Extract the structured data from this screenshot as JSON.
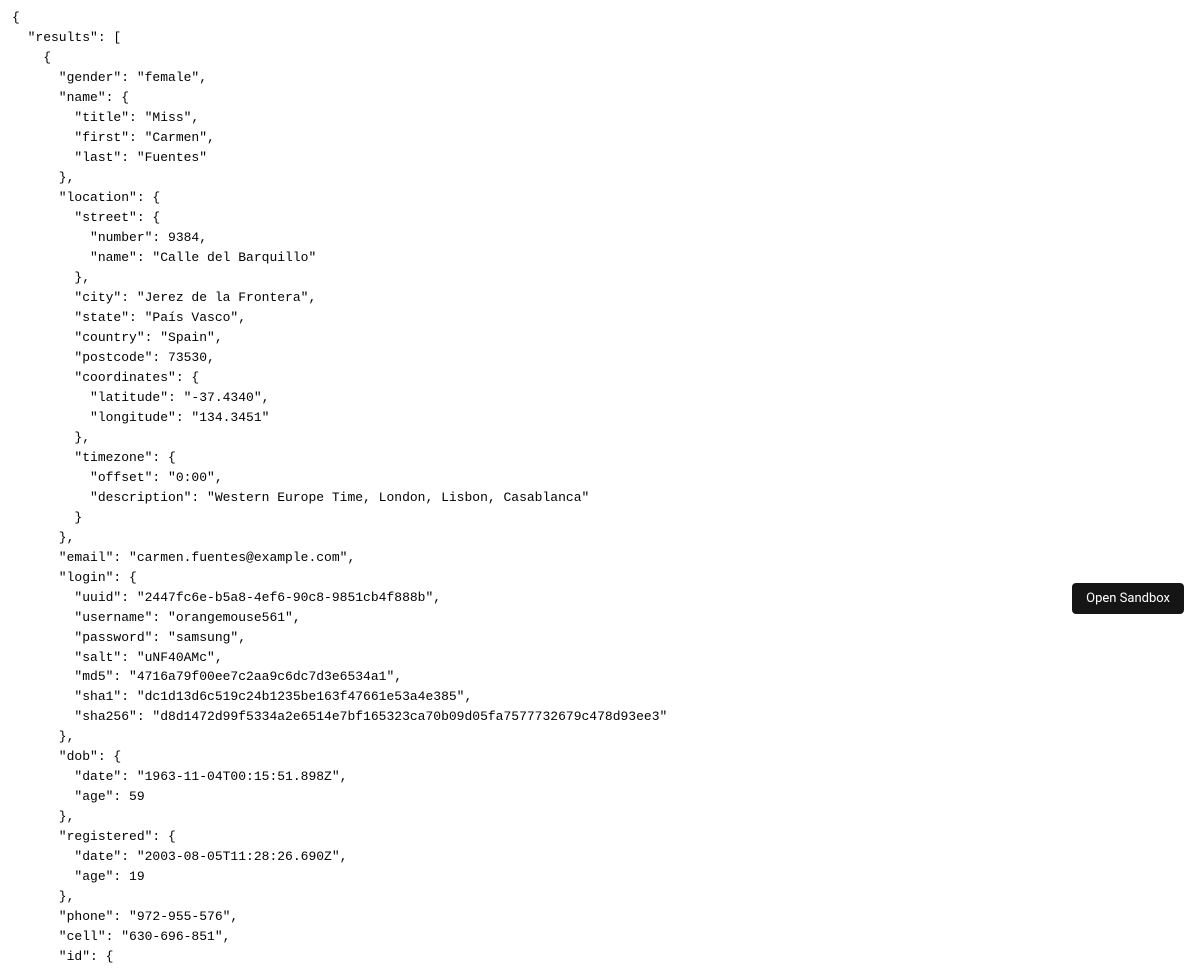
{
  "button": {
    "open_sandbox": "Open Sandbox"
  },
  "json_display": {
    "results": [
      {
        "gender": "female",
        "name": {
          "title": "Miss",
          "first": "Carmen",
          "last": "Fuentes"
        },
        "location": {
          "street": {
            "number": 9384,
            "name": "Calle del Barquillo"
          },
          "city": "Jerez de la Frontera",
          "state": "País Vasco",
          "country": "Spain",
          "postcode": 73530,
          "coordinates": {
            "latitude": "-37.4340",
            "longitude": "134.3451"
          },
          "timezone": {
            "offset": "0:00",
            "description": "Western Europe Time, London, Lisbon, Casablanca"
          }
        },
        "email": "carmen.fuentes@example.com",
        "login": {
          "uuid": "2447fc6e-b5a8-4ef6-90c8-9851cb4f888b",
          "username": "orangemouse561",
          "password": "samsung",
          "salt": "uNF40AMc",
          "md5": "4716a79f00ee7c2aa9c6dc7d3e6534a1",
          "sha1": "dc1d13d6c519c24b1235be163f47661e53a4e385",
          "sha256": "d8d1472d99f5334a2e6514e7bf165323ca70b09d05fa7577732679c478d93ee3"
        },
        "dob": {
          "date": "1963-11-04T00:15:51.898Z",
          "age": 59
        },
        "registered": {
          "date": "2003-08-05T11:28:26.690Z",
          "age": 19
        },
        "phone": "972-955-576",
        "cell": "630-696-851"
      }
    ]
  }
}
